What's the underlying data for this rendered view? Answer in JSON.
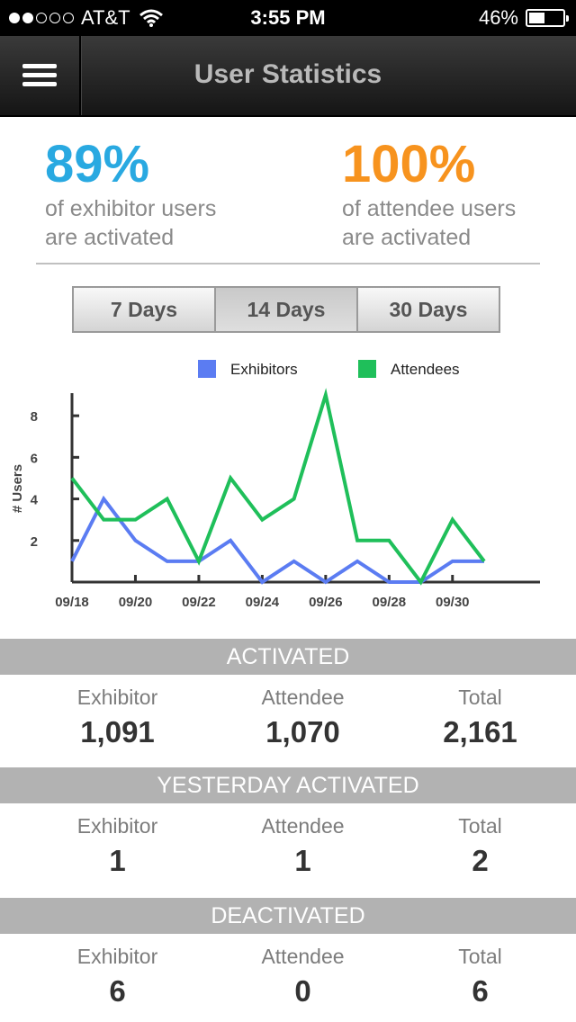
{
  "status_bar": {
    "carrier": "AT&T",
    "time": "3:55 PM",
    "battery": "46%",
    "battery_level": 0.46,
    "signal_bars": 2,
    "icons": [
      "signal-dots",
      "wifi-icon",
      "battery-icon"
    ]
  },
  "nav": {
    "title": "User Statistics",
    "menu_icon": "hamburger-menu-icon"
  },
  "stats": {
    "exhibitor_pct": "89%",
    "exhibitor_line1": "of exhibitor users",
    "exhibitor_line2": "are activated",
    "attendee_pct": "100%",
    "attendee_line1": "of attendee users",
    "attendee_line2": "are activated"
  },
  "colors": {
    "exhibitor_accent": "#29a9e1",
    "attendee_accent": "#f7931e",
    "exhibitors_series": "#5b7cf2",
    "attendees_series": "#1fbf5a"
  },
  "range_selector": {
    "options": [
      "7 Days",
      "14 Days",
      "30 Days"
    ],
    "selected": "14 Days"
  },
  "chart_data": {
    "type": "line",
    "title": "",
    "xlabel": "",
    "ylabel": "# Users",
    "x": [
      "09/18",
      "09/19",
      "09/20",
      "09/21",
      "09/22",
      "09/23",
      "09/24",
      "09/25",
      "09/26",
      "09/27",
      "09/28",
      "09/29",
      "09/30",
      "10/01"
    ],
    "x_tick_labels": [
      "09/18",
      "09/20",
      "09/22",
      "09/24",
      "09/26",
      "09/28",
      "09/30"
    ],
    "y_ticks": [
      2,
      4,
      6,
      8
    ],
    "ylim": [
      0,
      9
    ],
    "legend_position": "top",
    "grid": false,
    "series": [
      {
        "name": "Exhibitors",
        "color": "#5b7cf2",
        "values": [
          1,
          4,
          2,
          1,
          1,
          2,
          0,
          1,
          0,
          1,
          0,
          0,
          1,
          1
        ]
      },
      {
        "name": "Attendees",
        "color": "#1fbf5a",
        "values": [
          5,
          3,
          3,
          4,
          1,
          5,
          3,
          4,
          9,
          2,
          2,
          0,
          3,
          1
        ]
      }
    ]
  },
  "sections": [
    {
      "title": "ACTIVATED",
      "cols": [
        {
          "label": "Exhibitor",
          "value": "1,091"
        },
        {
          "label": "Attendee",
          "value": "1,070"
        },
        {
          "label": "Total",
          "value": "2,161"
        }
      ]
    },
    {
      "title": "YESTERDAY ACTIVATED",
      "cols": [
        {
          "label": "Exhibitor",
          "value": "1"
        },
        {
          "label": "Attendee",
          "value": "1"
        },
        {
          "label": "Total",
          "value": "2"
        }
      ]
    },
    {
      "title": "DEACTIVATED",
      "cols": [
        {
          "label": "Exhibitor",
          "value": "6"
        },
        {
          "label": "Attendee",
          "value": "0"
        },
        {
          "label": "Total",
          "value": "6"
        }
      ]
    }
  ]
}
